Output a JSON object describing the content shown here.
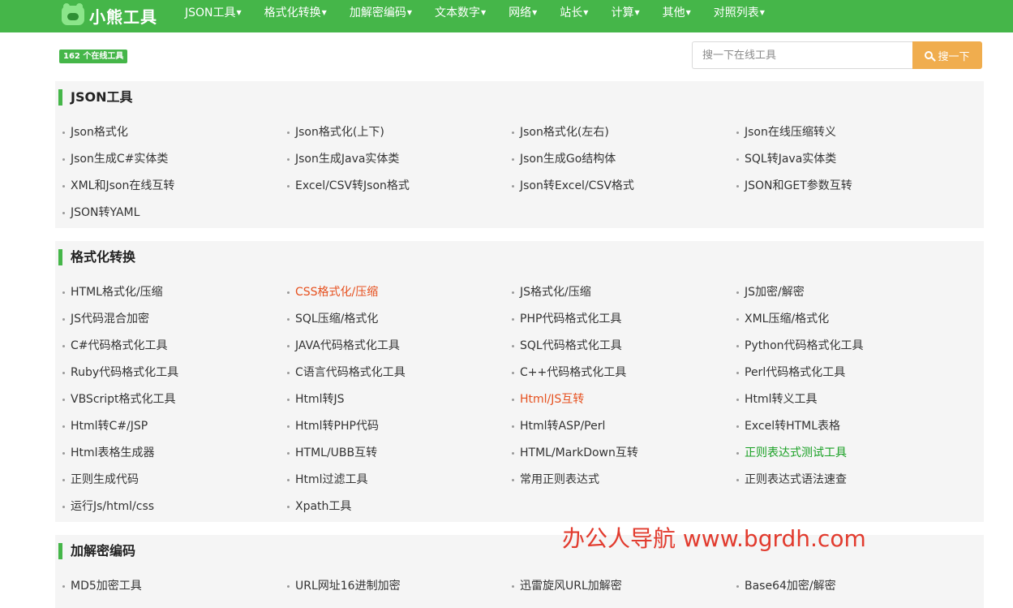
{
  "header": {
    "logo_text": "小熊工具",
    "nav": [
      {
        "label": "JSON工具"
      },
      {
        "label": "格式化转换"
      },
      {
        "label": "加解密编码"
      },
      {
        "label": "文本数字"
      },
      {
        "label": "网络"
      },
      {
        "label": "站长"
      },
      {
        "label": "计算"
      },
      {
        "label": "其他"
      },
      {
        "label": "对照列表"
      }
    ]
  },
  "badge": "162 个在线工具",
  "search": {
    "placeholder": "搜一下在线工具",
    "button_label": "搜一下"
  },
  "sections": [
    {
      "title": "JSON工具",
      "tools": [
        "Json格式化",
        "Json格式化(上下)",
        "Json格式化(左右)",
        "Json在线压缩转义",
        "Json生成C#实体类",
        "Json生成Java实体类",
        "Json生成Go结构体",
        "SQL转Java实体类",
        "XML和Json在线互转",
        "Excel/CSV转Json格式",
        "Json转Excel/CSV格式",
        "JSON和GET参数互转",
        "JSON转YAML"
      ]
    },
    {
      "title": "格式化转换",
      "tools": [
        "HTML格式化/压缩",
        "CSS格式化/压缩",
        "JS格式化/压缩",
        "JS加密/解密",
        "JS代码混合加密",
        "SQL压缩/格式化",
        "PHP代码格式化工具",
        "XML压缩/格式化",
        "C#代码格式化工具",
        "JAVA代码格式化工具",
        "SQL代码格式化工具",
        "Python代码格式化工具",
        "Ruby代码格式化工具",
        "C语言代码格式化工具",
        "C++代码格式化工具",
        "Perl代码格式化工具",
        "VBScript格式化工具",
        "Html转JS",
        "Html/JS互转",
        "Html转义工具",
        "Html转C#/JSP",
        "Html转PHP代码",
        "Html转ASP/Perl",
        "Excel转HTML表格",
        "Html表格生成器",
        "HTML/UBB互转",
        "HTML/MarkDown互转",
        "正则表达式测试工具",
        "正则生成代码",
        "Html过滤工具",
        "常用正则表达式",
        "正则表达式语法速查",
        "运行Js/html/css",
        "Xpath工具"
      ]
    },
    {
      "title": "加解密编码",
      "tools": [
        "MD5加密工具",
        "URL网址16进制加密",
        "迅雷旋风URL加解密",
        "Base64加密/解密"
      ]
    }
  ],
  "watermark": "办公人导航 www.bgrdh.com",
  "colors": {
    "nav_green": "#45b649",
    "search_button": "#f0ad4e",
    "highlight_red": "#e6501e",
    "highlight_green": "#19a024"
  }
}
